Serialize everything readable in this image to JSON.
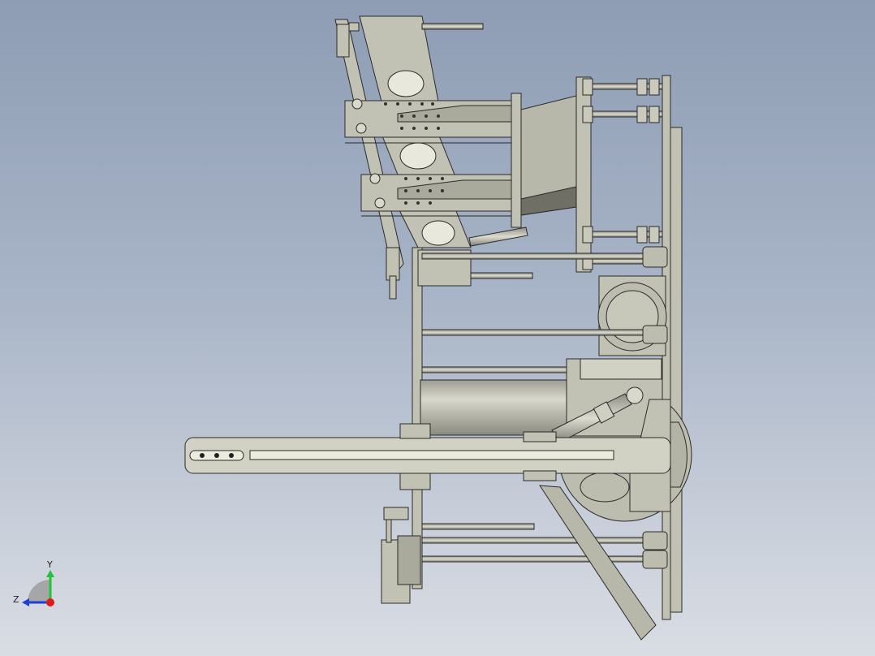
{
  "viewport": {
    "background_top": "#8e9db4",
    "background_bottom": "#d9dde4",
    "part_fill": "#c2c2b4",
    "part_fill_light": "#d6d6c8",
    "part_edge": "#2a2a2a",
    "dark_shade": "#6f6f66"
  },
  "triad": {
    "y_label": "Y",
    "z_label": "Z",
    "y_color": "#23c23a",
    "z_color": "#1f3fd6",
    "x_color": "#e01818"
  }
}
